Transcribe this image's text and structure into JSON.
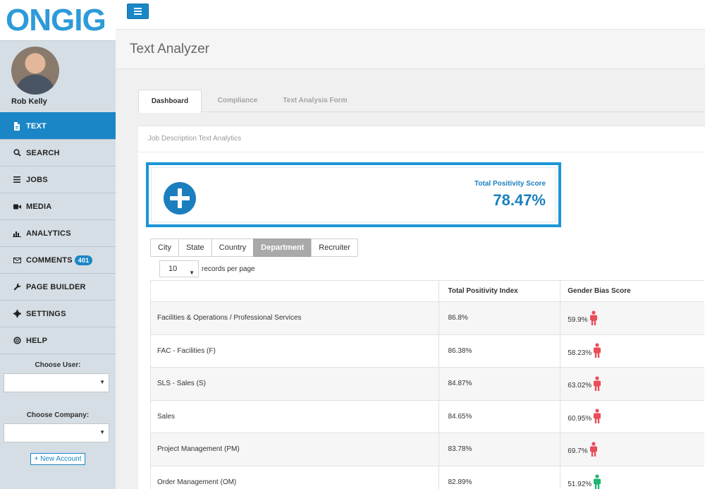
{
  "brand": {
    "logo_text": "ONGIG",
    "accent": "#1b86c6"
  },
  "user": {
    "name": "Rob Kelly"
  },
  "sidebar": {
    "items": [
      {
        "label": "TEXT",
        "icon": "document-icon",
        "active": true
      },
      {
        "label": "SEARCH",
        "icon": "search-icon"
      },
      {
        "label": "JOBS",
        "icon": "list-icon"
      },
      {
        "label": "MEDIA",
        "icon": "video-camera-icon"
      },
      {
        "label": "ANALYTICS",
        "icon": "bar-chart-icon"
      },
      {
        "label": "COMMENTS",
        "icon": "envelope-icon",
        "badge": "401"
      },
      {
        "label": "PAGE BUILDER",
        "icon": "wrench-icon"
      },
      {
        "label": "SETTINGS",
        "icon": "gear-icon"
      },
      {
        "label": "HELP",
        "icon": "life-ring-icon"
      }
    ],
    "choose_user_label": "Choose User:",
    "choose_user_value": "",
    "choose_company_label": "Choose Company:",
    "choose_company_value": "",
    "new_account_label": "+ New Account"
  },
  "header": {
    "title": "Text Analyzer"
  },
  "tabs": [
    {
      "label": "Dashboard",
      "active": true
    },
    {
      "label": "Compliance"
    },
    {
      "label": "Text Analysis Form"
    }
  ],
  "panel": {
    "heading": "Job Description Text Analytics",
    "score": {
      "label": "Total Positivity Score",
      "value": "78.47%"
    },
    "filters": [
      {
        "label": "City"
      },
      {
        "label": "State"
      },
      {
        "label": "Country"
      },
      {
        "label": "Department",
        "active": true
      },
      {
        "label": "Recruiter"
      }
    ],
    "records": {
      "value": "10",
      "suffix": "records per page"
    },
    "table": {
      "columns": [
        "",
        "Total Positivity Index",
        "Gender Bias Score"
      ],
      "rows": [
        {
          "name": "Facilities & Operations / Professional Services",
          "tpi": "86.8%",
          "gbs": "59.9%",
          "gender_color": "#e94d5a"
        },
        {
          "name": "FAC - Facilities (F)",
          "tpi": "86.38%",
          "gbs": "58.23%",
          "gender_color": "#e94d5a"
        },
        {
          "name": "SLS - Sales (S)",
          "tpi": "84.87%",
          "gbs": "63.02%",
          "gender_color": "#e94d5a"
        },
        {
          "name": "Sales",
          "tpi": "84.65%",
          "gbs": "60.95%",
          "gender_color": "#e94d5a"
        },
        {
          "name": "Project Management (PM)",
          "tpi": "83.78%",
          "gbs": "69.7%",
          "gender_color": "#e94d5a"
        },
        {
          "name": "Order Management (OM)",
          "tpi": "82.89%",
          "gbs": "51.92%",
          "gender_color": "#20b573"
        }
      ]
    }
  }
}
